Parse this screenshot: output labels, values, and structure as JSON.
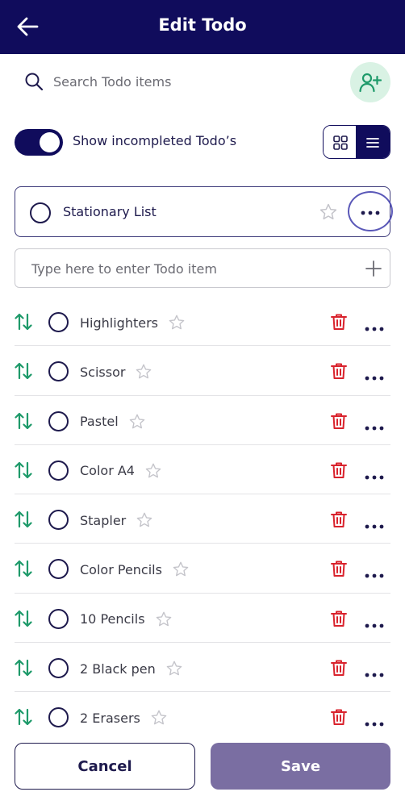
{
  "header": {
    "title": "Edit Todo",
    "back_icon": "arrow-left-icon"
  },
  "search": {
    "placeholder": "Search Todo items",
    "value": "",
    "add_user_icon": "user-plus-icon"
  },
  "toggle": {
    "label": "Show incompleted Todo’s",
    "on": true
  },
  "view_switch": {
    "options": [
      "grid",
      "list"
    ],
    "selected": "list"
  },
  "list_card": {
    "title": "Stationary List",
    "starred": false
  },
  "add_item": {
    "placeholder": "Type here to enter Todo item",
    "value": ""
  },
  "todos": [
    {
      "label": "Highlighters"
    },
    {
      "label": "Scissor"
    },
    {
      "label": "Pastel"
    },
    {
      "label": "Color A4"
    },
    {
      "label": "Stapler"
    },
    {
      "label": "Color Pencils"
    },
    {
      "label": "10 Pencils"
    },
    {
      "label": "2 Black pen"
    },
    {
      "label": "2 Erasers"
    }
  ],
  "footer": {
    "cancel_label": "Cancel",
    "save_label": "Save"
  },
  "colors": {
    "header_bg": "#100c5c",
    "accent_green": "#1e9a6a",
    "trash_red": "#d9232d",
    "save_bg": "#7a6ea2",
    "add_user_bg": "#d9f2e4"
  }
}
